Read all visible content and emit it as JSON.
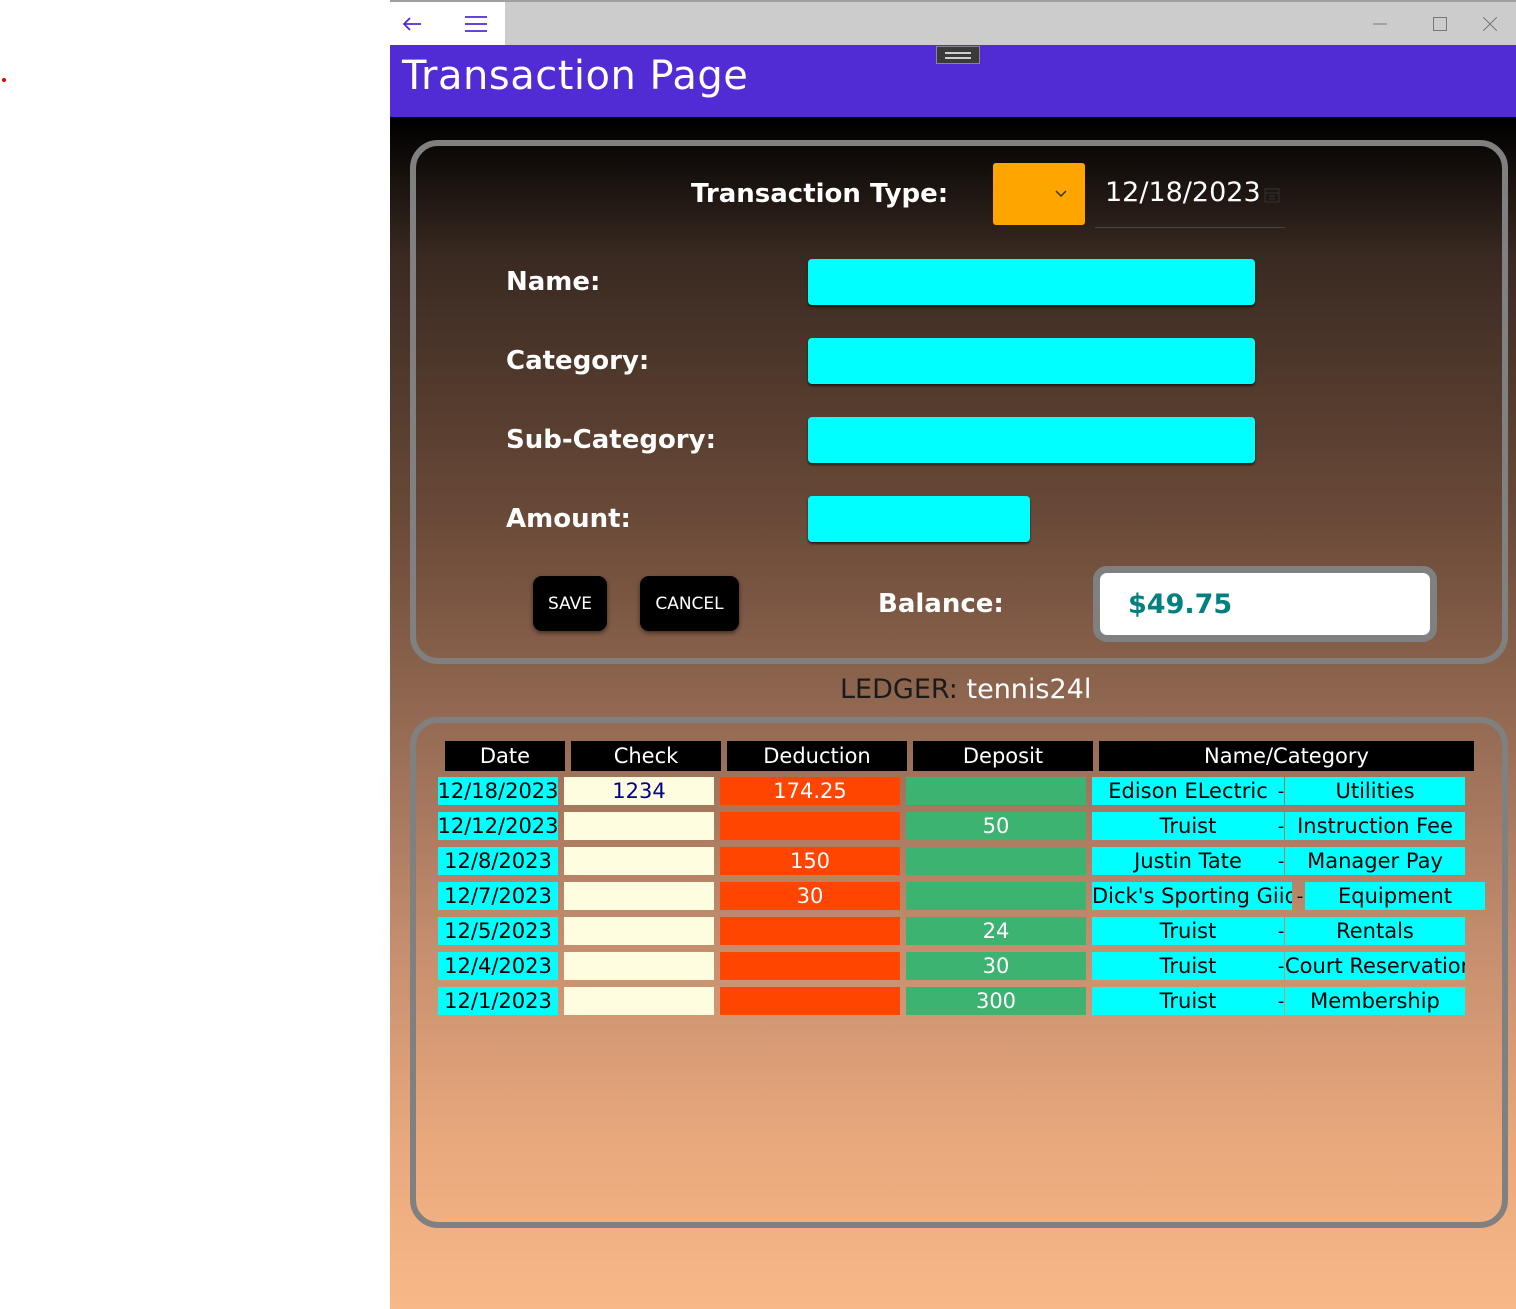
{
  "page": {
    "title": "Transaction Page"
  },
  "icons": {
    "back": "back-arrow-icon",
    "menu": "hamburger-icon",
    "minimize": "minimize-icon",
    "maximize": "maximize-icon",
    "close": "close-icon",
    "calendar": "calendar-icon",
    "chevron": "chevron-down-icon"
  },
  "form": {
    "transaction_type_label": "Transaction Type:",
    "transaction_type_value": "",
    "date": "12/18/2023",
    "name_label": "Name:",
    "name_value": "",
    "category_label": "Category:",
    "category_value": "",
    "subcategory_label": "Sub-Category:",
    "subcategory_value": "",
    "amount_label": "Amount:",
    "amount_value": "",
    "save_label": "SAVE",
    "cancel_label": "CANCEL",
    "balance_label": "Balance:",
    "balance_value": "$49.75"
  },
  "ledger": {
    "label": "LEDGER:",
    "name": "tennis24l",
    "columns": [
      "Date",
      "Check",
      "Deduction",
      "Deposit",
      "Name/Category"
    ],
    "rows": [
      {
        "date": "12/18/2023",
        "check": "1234",
        "deduction": "174.25",
        "deposit": "",
        "name": "Edison ELectric",
        "sep": "-",
        "category": "Utilities"
      },
      {
        "date": "12/12/2023",
        "check": "",
        "deduction": "",
        "deposit": "50",
        "name": "Truist",
        "sep": "-",
        "category": "Instruction Fee"
      },
      {
        "date": "12/8/2023",
        "check": "",
        "deduction": "150",
        "deposit": "",
        "name": "Justin Tate",
        "sep": "-",
        "category": "Manager Pay"
      },
      {
        "date": "12/7/2023",
        "check": "",
        "deduction": "30",
        "deposit": "",
        "name": "Dick's Sporting Giids",
        "sep": "-",
        "category": "Equipment"
      },
      {
        "date": "12/5/2023",
        "check": "",
        "deduction": "",
        "deposit": "24",
        "name": "Truist",
        "sep": "-",
        "category": "Rentals"
      },
      {
        "date": "12/4/2023",
        "check": "",
        "deduction": "",
        "deposit": "30",
        "name": "Truist",
        "sep": "-",
        "category": "Court Reservation"
      },
      {
        "date": "12/1/2023",
        "check": "",
        "deduction": "",
        "deposit": "300",
        "name": "Truist",
        "sep": "-",
        "category": "Membership"
      }
    ]
  },
  "colors": {
    "header": "#512bd4",
    "picker": "#ffa500",
    "field": "#00ffff",
    "deduction": "#ff4500",
    "deposit": "#3cb371",
    "check": "#fffde0",
    "balance_text": "#008080"
  }
}
